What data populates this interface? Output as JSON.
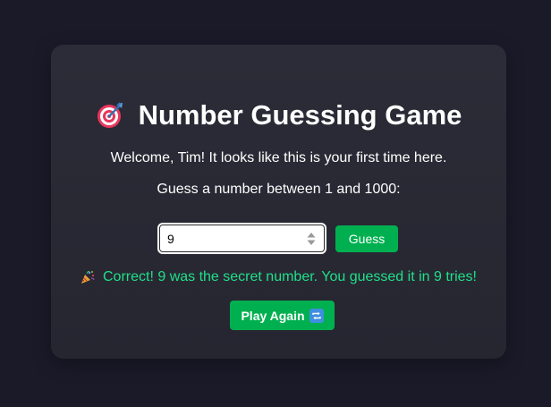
{
  "game": {
    "title": "Number Guessing Game",
    "title_icon": "direct-hit-target-icon",
    "welcome": "Welcome, Tim! It looks like this is your first time here.",
    "instruction": "Guess a number between 1 and 1000:"
  },
  "guess_form": {
    "input_value": "9",
    "stepper_icon": "number-stepper-icon",
    "button_label": "Guess"
  },
  "result": {
    "icon": "party-popper-icon",
    "message": "Correct! 9 was the secret number. You guessed it in 9 tries!"
  },
  "play_again": {
    "label": "Play Again",
    "icon": "repeat-icon"
  },
  "colors": {
    "page_background": "#1b1a29",
    "card_background": "#2a2a35",
    "accent_green": "#00b050",
    "success_text": "#1fe088",
    "text": "#ffffff"
  }
}
